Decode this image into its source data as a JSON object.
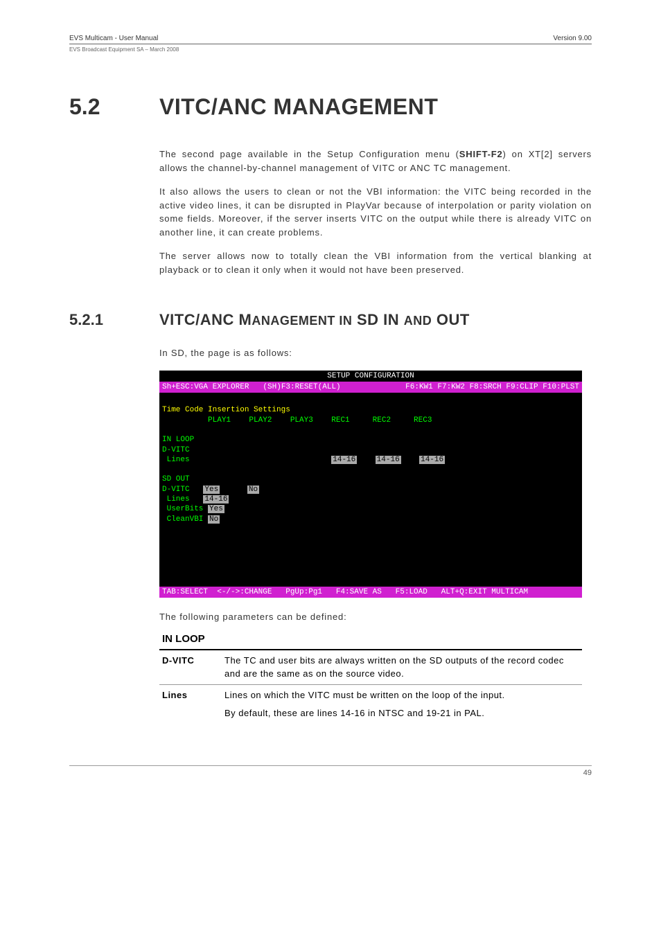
{
  "header": {
    "left": "EVS Multicam - User Manual",
    "right": "Version 9.00",
    "sub": "EVS Broadcast Equipment SA – March 2008"
  },
  "section": {
    "num": "5.2",
    "title": "VITC/ANC MANAGEMENT"
  },
  "paragraphs": {
    "p1a": "The second page available in the Setup Configuration menu (",
    "p1b": "SHIFT-F2",
    "p1c": ") on XT[2] servers allows the channel-by-channel management of VITC or ANC TC management.",
    "p2": "It also allows the users to clean or not the VBI information: the VITC being recorded in the active video lines, it can be disrupted in PlayVar because of interpolation or parity violation on some fields. Moreover, if the server inserts VITC on the output while there is already VITC on another line, it can create problems.",
    "p3": "The server allows now to totally clean the VBI information from the vertical blanking at playback or to clean it only when it would not have been preserved."
  },
  "subsection": {
    "num": "5.2.1",
    "title_pre": "VITC/ANC M",
    "title_sc1": "ANAGEMENT IN",
    "title_mid": " SD IN ",
    "title_sc2": "AND",
    "title_post": " OUT"
  },
  "sd_intro": "In SD, the page is as follows:",
  "terminal": {
    "title": "SETUP CONFIGURATION",
    "top": {
      "left": "Sh+ESC:VGA EXPLORER",
      "mid": "(SH)F3:RESET(ALL)",
      "right": "F6:KW1 F7:KW2 F8:SRCH F9:CLIP F10:PLST"
    },
    "heading": "Time Code Insertion Settings",
    "cols": "          PLAY1    PLAY2    PLAY3    REC1     REC2     REC3",
    "inloop": "IN LOOP",
    "dvitc1": "D-VITC",
    "lines1a": " Lines                               ",
    "lines1_v1": "14-16",
    "lines1_v2": "14-16",
    "lines1_v3": "14-16",
    "sdout": "SD OUT",
    "dvitc2a": "D-VITC   ",
    "dvitc2_v1": "Yes",
    "dvitc2_sp": "      ",
    "dvitc2_v2": "No",
    "lines2a": " Lines   ",
    "lines2_v": "14-16",
    "userbitsa": " UserBits ",
    "userbits_v": "Yes",
    "cleanvbia": " CleanVBI ",
    "cleanvbi_v": "No",
    "bottom": "TAB:SELECT  <-/->:CHANGE   PgUp:Pg1   F4:SAVE AS   F5:LOAD   ALT+Q:EXIT MULTICAM"
  },
  "param_intro": "The following parameters can be defined:",
  "params": {
    "section1": "IN LOOP",
    "row1": {
      "label": "D-VITC",
      "text": "The TC and user bits are always written on the SD outputs of the record codec and are the same as on the source video."
    },
    "row2": {
      "label": "Lines",
      "text1": "Lines on which the VITC must be written on the loop of the input.",
      "text2": "By default, these are lines 14-16 in NTSC and 19-21 in PAL."
    }
  },
  "footer": {
    "page": "49"
  }
}
